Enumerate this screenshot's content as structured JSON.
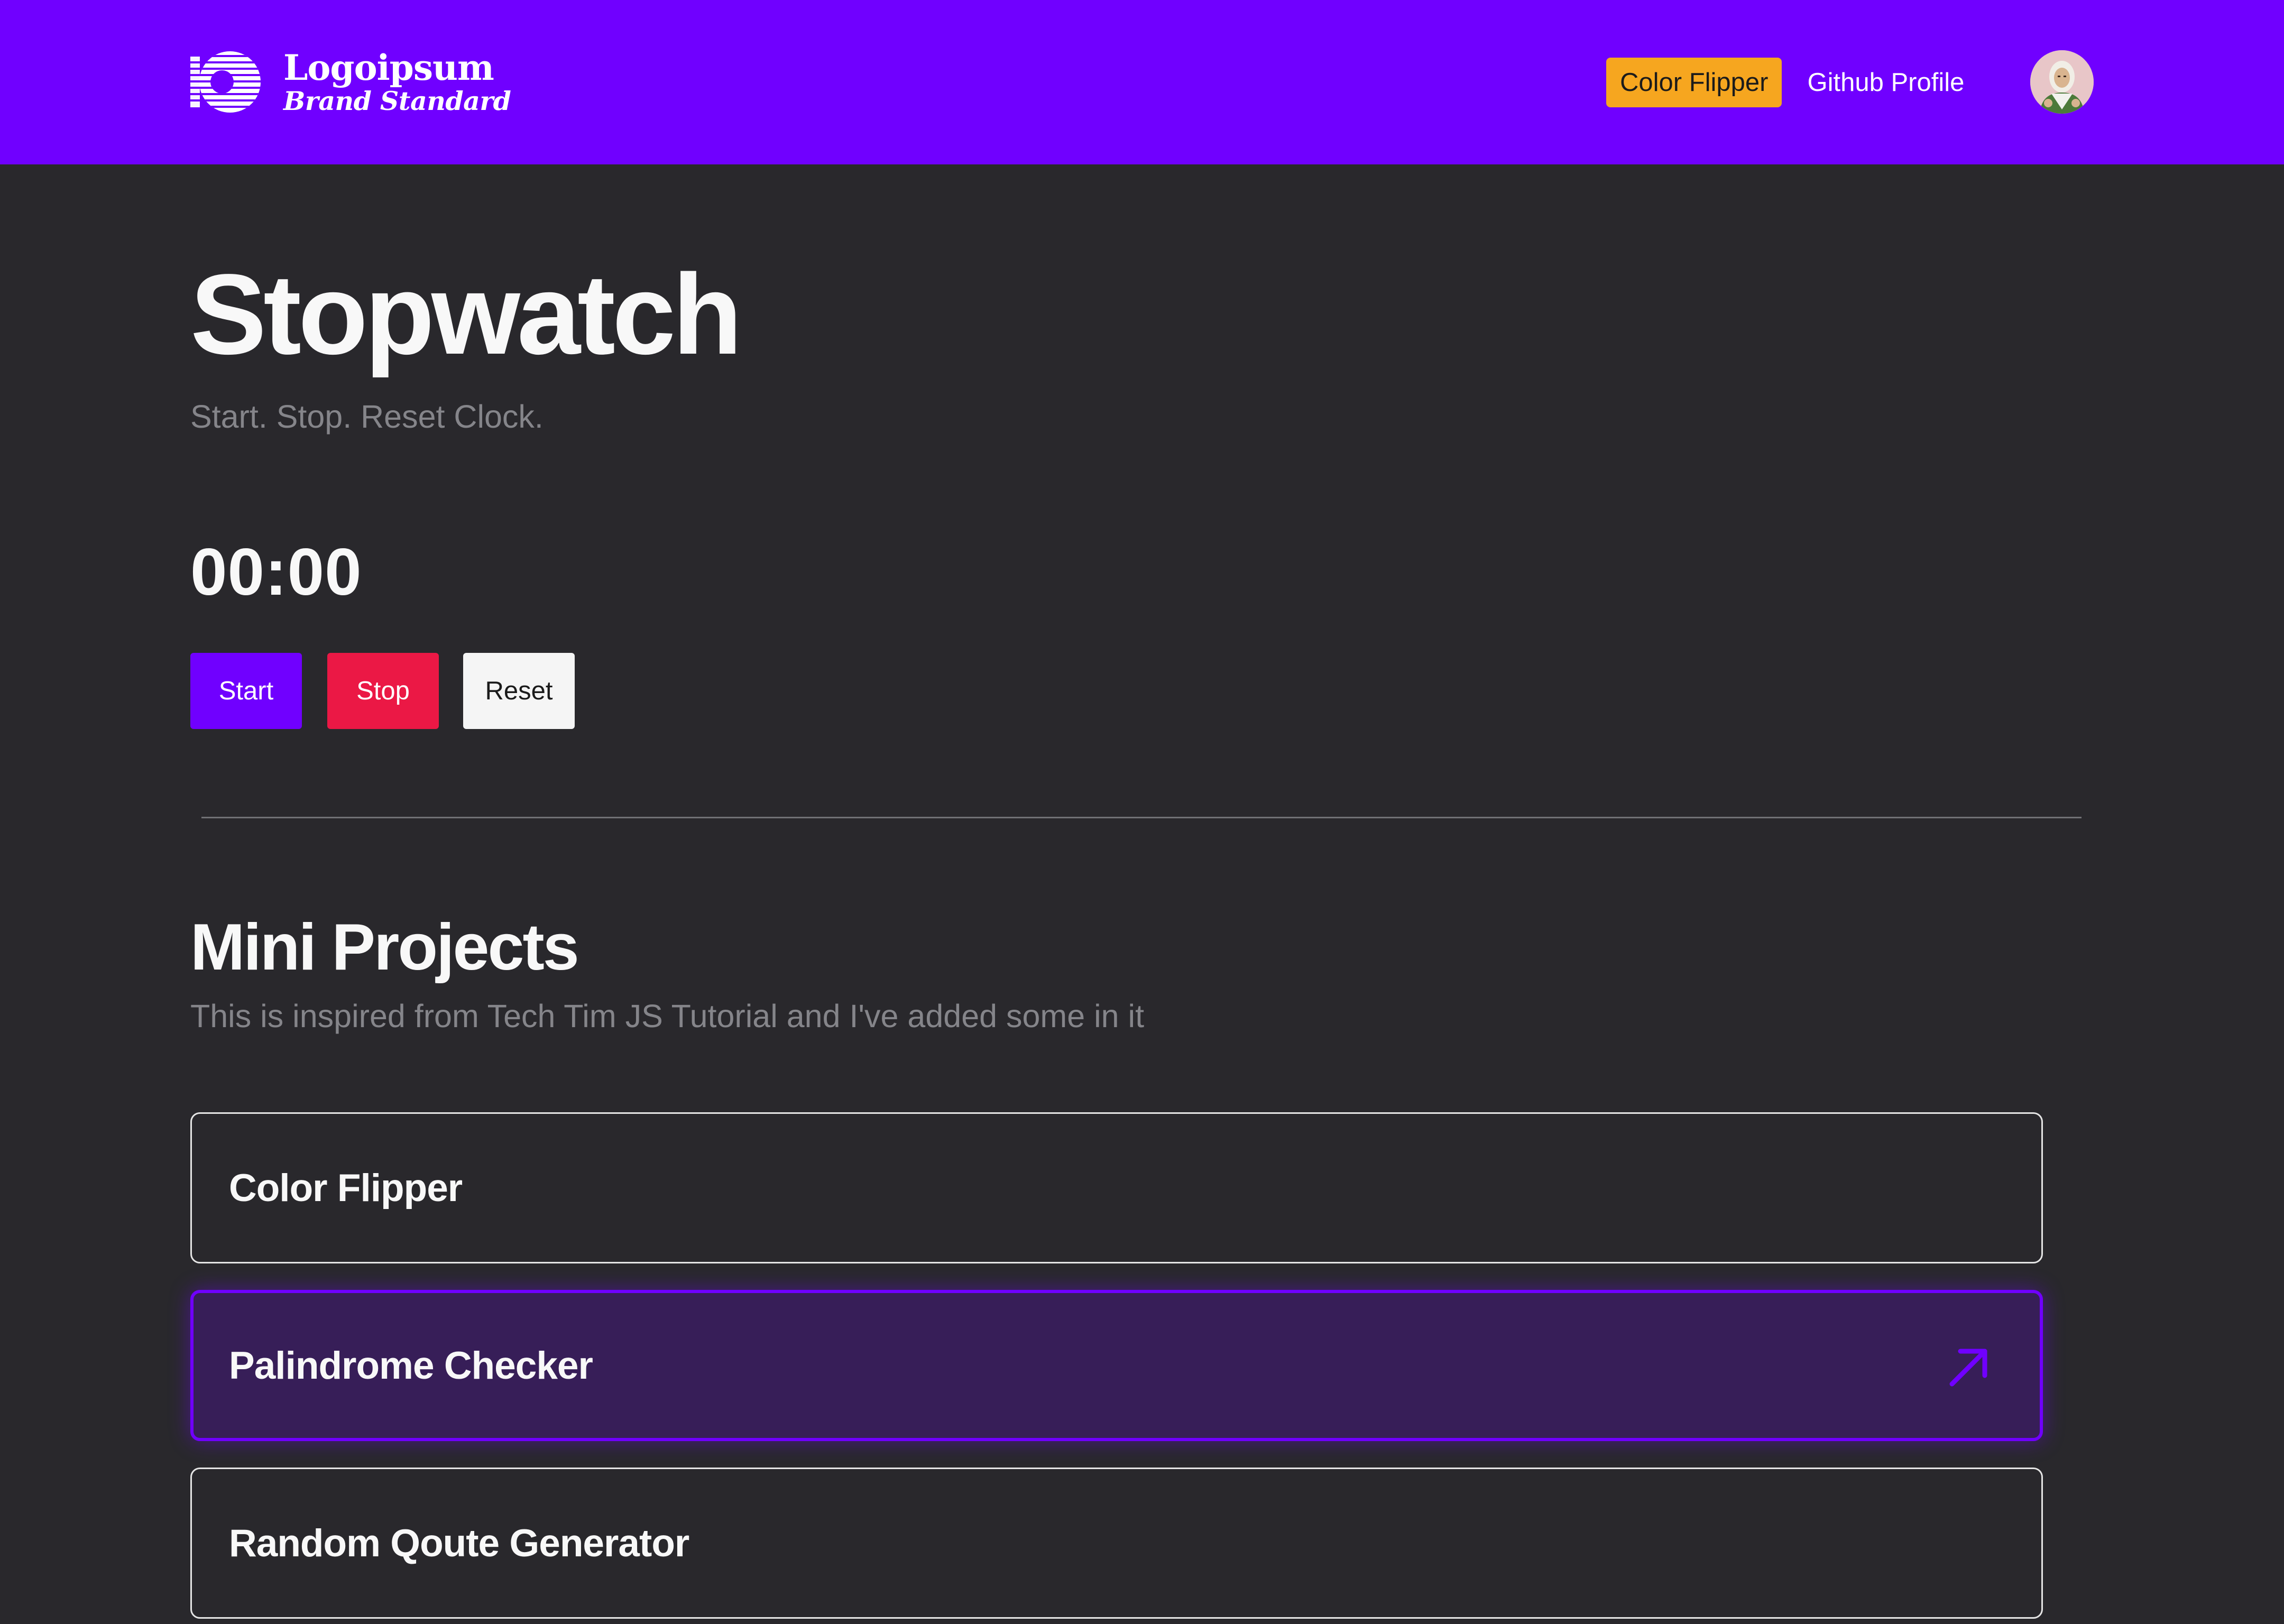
{
  "header": {
    "logo": {
      "name": "Logoipsum",
      "subtitle": "Brand Standard",
      "icon": "logo-mark-icon"
    },
    "nav": {
      "color_flipper": "Color Flipper",
      "github_profile": "Github Profile"
    },
    "avatar_icon": "user-avatar"
  },
  "stopwatch": {
    "title": "Stopwatch",
    "subtitle": "Start. Stop. Reset Clock.",
    "time": "00:00",
    "buttons": {
      "start": "Start",
      "stop": "Stop",
      "reset": "Reset"
    }
  },
  "mini_projects": {
    "title": "Mini Projects",
    "subtitle": "This is inspired from Tech Tim JS Tutorial and I've added some in it",
    "items": [
      {
        "label": "Color Flipper",
        "state": "default"
      },
      {
        "label": "Palindrome Checker",
        "state": "hovered",
        "icon": "arrow-up-right-icon"
      },
      {
        "label": "Random Qoute Generator",
        "state": "default"
      }
    ]
  },
  "colors": {
    "brand_purple": "#7000ff",
    "page_background": "#29282c",
    "nav_pill": "#f6a61f",
    "stop_red": "#eb1845",
    "reset_white": "#f5f5f5",
    "muted_text": "#85858a",
    "hover_card_background": "#371e58"
  }
}
